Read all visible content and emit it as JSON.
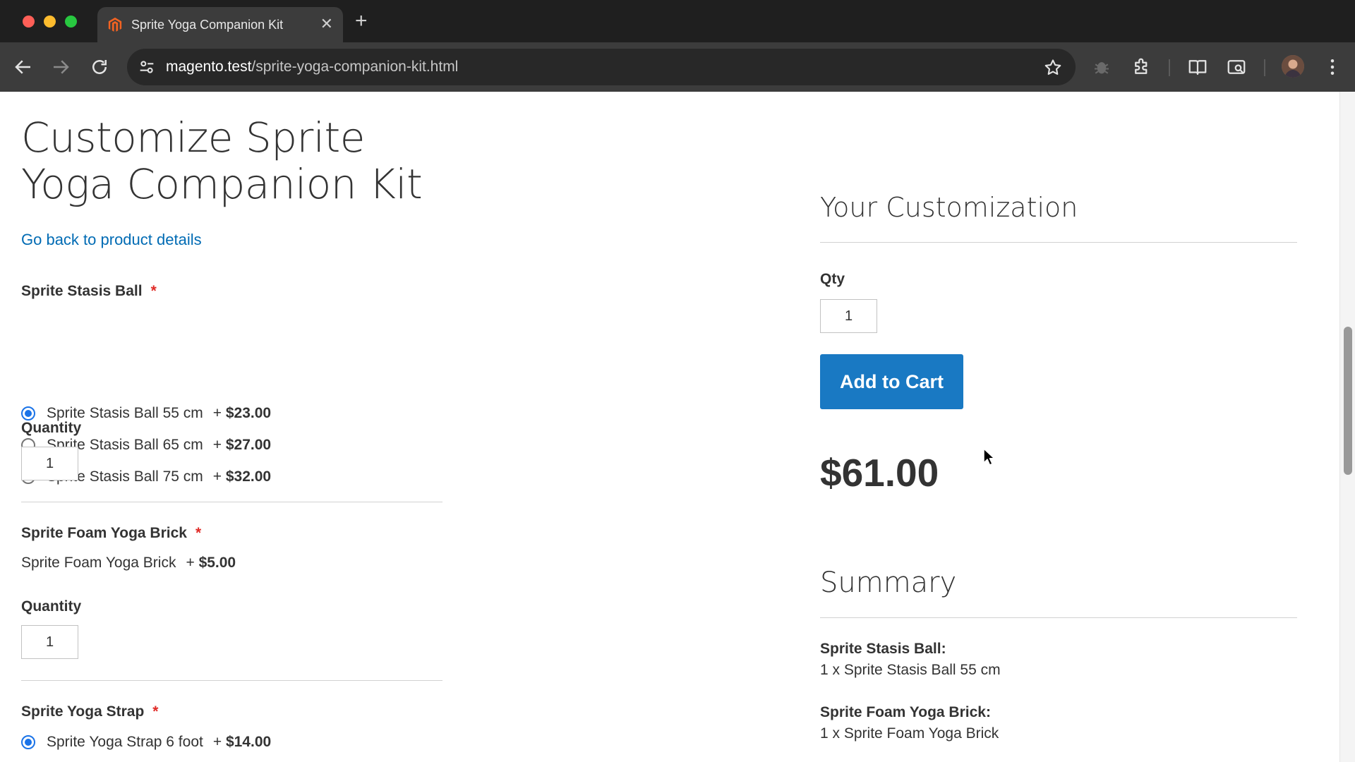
{
  "browser": {
    "tab_title": "Sprite Yoga Companion Kit",
    "url_host": "magento.test",
    "url_path": "/sprite-yoga-companion-kit.html",
    "icons": [
      "back-icon",
      "forward-icon",
      "reload-icon",
      "site-info-icon",
      "bookmark-star-icon",
      "extension-bug-icon",
      "extensions-icon",
      "reading-list-icon",
      "lens-icon",
      "menu-icon"
    ]
  },
  "page": {
    "title": "Customize Sprite Yoga Companion Kit",
    "back_link": "Go back to product details",
    "required_mark": "*",
    "quantity_label": "Quantity",
    "options": [
      {
        "title": "Sprite Stasis Ball",
        "choices": [
          {
            "label": "Sprite Stasis Ball 55 cm",
            "plus": "+",
            "price": "$23.00",
            "selected": true
          },
          {
            "label": "Sprite Stasis Ball 65 cm",
            "plus": "+",
            "price": "$27.00",
            "selected": false
          },
          {
            "label": "Sprite Stasis Ball 75 cm",
            "plus": "+",
            "price": "$32.00",
            "selected": false
          }
        ],
        "quantity": "1"
      },
      {
        "title": "Sprite Foam Yoga Brick",
        "single": {
          "label": "Sprite Foam Yoga Brick",
          "plus": "+",
          "price": "$5.00"
        },
        "quantity": "1"
      },
      {
        "title": "Sprite Yoga Strap",
        "choices": [
          {
            "label": "Sprite Yoga Strap 6 foot",
            "plus": "+",
            "price": "$14.00",
            "selected": true
          }
        ]
      }
    ],
    "customization": {
      "title": "Your Customization",
      "qty_label": "Qty",
      "qty_value": "1",
      "add_to_cart": "Add to Cart",
      "price": "$61.00"
    },
    "summary": {
      "title": "Summary",
      "items": [
        {
          "label": "Sprite Stasis Ball:",
          "value": "1 x Sprite Stasis Ball 55 cm"
        },
        {
          "label": "Sprite Foam Yoga Brick:",
          "value": "1 x Sprite Foam Yoga Brick"
        }
      ]
    }
  },
  "colors": {
    "link": "#006bb4",
    "primary_button": "#1979c3",
    "required": "#e02b27",
    "radio_checked": "#1a73e8"
  }
}
